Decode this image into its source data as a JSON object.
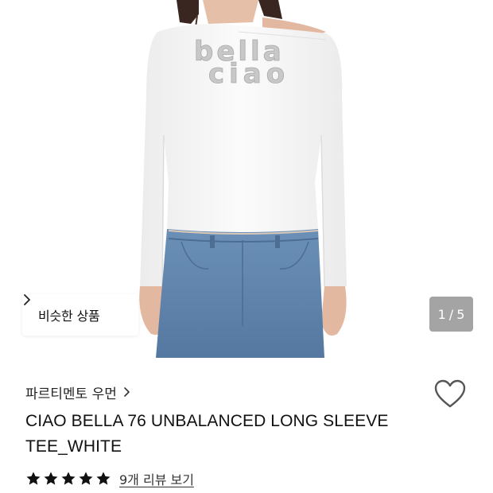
{
  "product": {
    "image_alt": "Model wearing white off-shoulder long sleeve tee with jeans",
    "print_text_line1": "bella",
    "print_text_line2": "ciao",
    "similar_label": "비슷한 상품",
    "counter_current": "1",
    "counter_sep": "/",
    "counter_total": "5",
    "brand": "파르티멘토 우먼",
    "title": "CIAO BELLA 76 UNBALANCED LONG SLEEVE TEE_WHITE",
    "rating": 5,
    "review_link": "9개 리뷰 보기"
  },
  "icons": {
    "similar_chevron": "chevron-right-icon",
    "brand_chevron": "chevron-right-icon",
    "wishlist": "heart-outline-icon",
    "star": "star-filled-icon"
  },
  "colors": {
    "tee": "#f7f7f7",
    "jeans": "#5f84aa",
    "skin": "#e3b8a0",
    "hair": "#3a2620",
    "star": "#111111",
    "heart_stroke": "#555555"
  }
}
